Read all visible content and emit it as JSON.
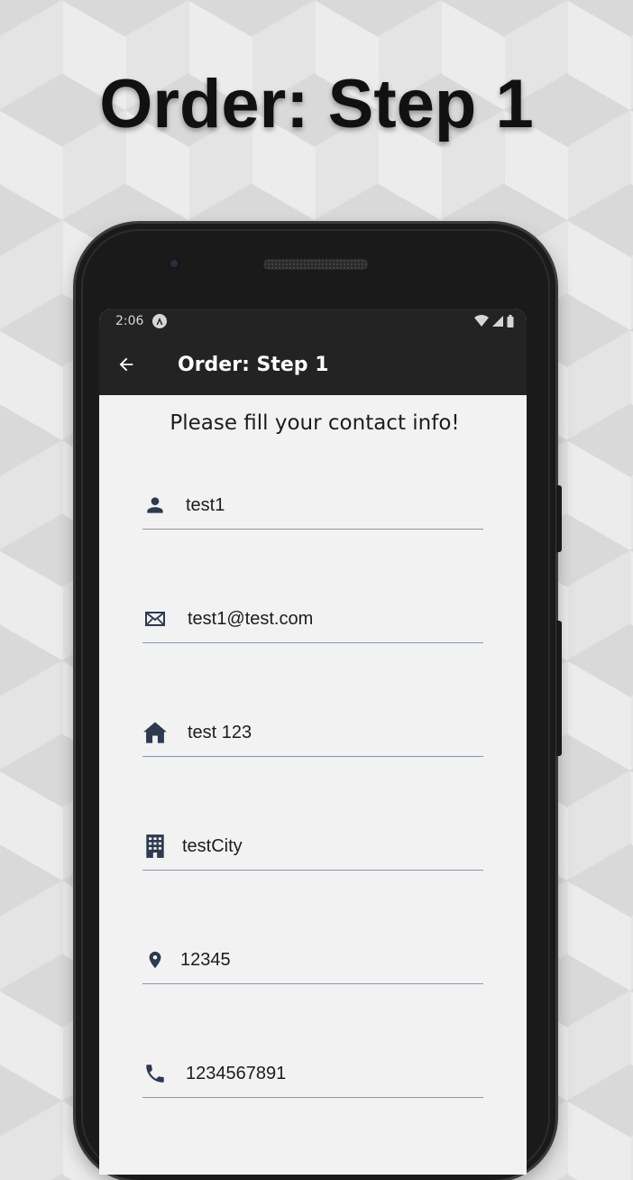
{
  "promo": {
    "title": "Order: Step 1"
  },
  "status_bar": {
    "time": "2:06"
  },
  "app_bar": {
    "title": "Order: Step 1",
    "back_icon": "arrow-left-icon"
  },
  "form": {
    "prompt": "Please fill your contact info!",
    "fields": [
      {
        "icon": "person-icon",
        "value": "test1"
      },
      {
        "icon": "email-icon",
        "value": "test1@test.com"
      },
      {
        "icon": "home-icon",
        "value": "test 123"
      },
      {
        "icon": "building-icon",
        "value": "testCity"
      },
      {
        "icon": "location-pin-icon",
        "value": "12345"
      },
      {
        "icon": "phone-icon",
        "value": "1234567891"
      }
    ]
  },
  "colors": {
    "app_bar": "#232323",
    "screen_bg": "#f2f2f2",
    "icon": "#2d3a4f",
    "underline": "#8a96a8"
  }
}
